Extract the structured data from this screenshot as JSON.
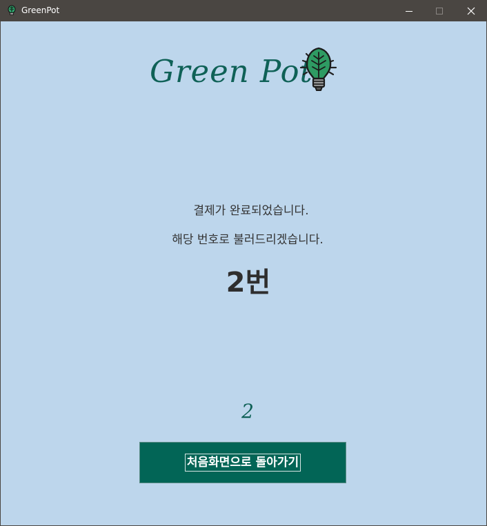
{
  "window": {
    "title": "GreenPot",
    "controls": {
      "minimize_icon": "minimize-icon",
      "maximize_icon": "maximize-icon",
      "close_icon": "close-icon"
    }
  },
  "logo": {
    "text": "Green Pot",
    "icon": "leaf-bulb-icon"
  },
  "message": {
    "line1": "결제가 완료되었습니다.",
    "line2": "해당 번호로 불러드리겠습니다.",
    "order_number": "2번"
  },
  "countdown": "2",
  "home_button": {
    "label": "처음화면으로 돌아가기"
  },
  "colors": {
    "background": "#bdd6ec",
    "titlebar": "#4a4642",
    "brand_green": "#0f6157",
    "button_bg": "#026556"
  }
}
